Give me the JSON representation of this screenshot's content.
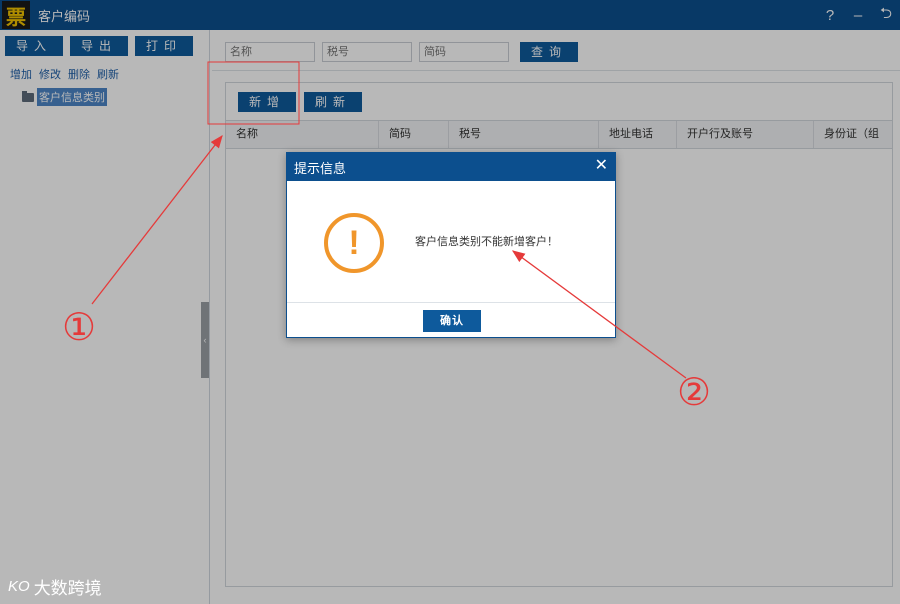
{
  "window": {
    "logo_char": "票",
    "title": "客户编码",
    "controls": {
      "help": "?",
      "minimize": "–",
      "back": "⮌"
    }
  },
  "left": {
    "buttons": {
      "import": "导入",
      "export": "导出",
      "print": "打印"
    },
    "actions": {
      "add": "增加",
      "edit": "修改",
      "delete": "删除",
      "refresh": "刷新"
    },
    "tree_root": "客户信息类别",
    "splitter_glyph": "‹"
  },
  "search": {
    "name_placeholder": "名称",
    "tax_placeholder": "税号",
    "code_placeholder": "简码",
    "query_label": "查询"
  },
  "grid": {
    "new_label": "新增",
    "refresh_label": "刷新",
    "columns": [
      "名称",
      "简码",
      "税号",
      "地址电话",
      "开户行及账号",
      "身份证（组"
    ]
  },
  "dialog": {
    "title": "提示信息",
    "close": "✕",
    "icon": "warning-icon",
    "icon_glyph": "!",
    "message": "客户信息类别不能新增客户！",
    "confirm": "确认"
  },
  "annotations": {
    "mark1": "①",
    "mark2": "②",
    "color": "#e53a3a"
  },
  "watermark": {
    "logo": "KO",
    "text": "大数跨境"
  },
  "colors": {
    "primary": "#0c4f8e",
    "button": "#0e5a9c",
    "warning": "#f0962b",
    "link": "#1e5fa8"
  }
}
